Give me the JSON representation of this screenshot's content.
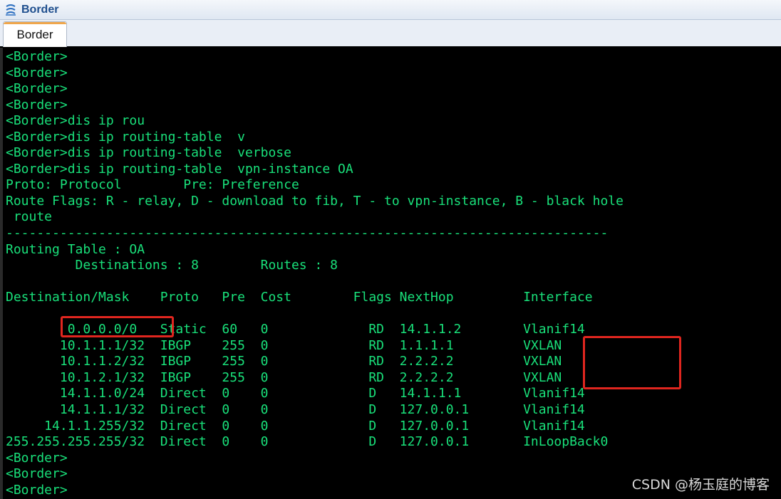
{
  "window": {
    "title": "Border",
    "icon": "network-device-icon"
  },
  "tabs": [
    {
      "label": "Border",
      "active": true
    }
  ],
  "terminal": {
    "text_color": "#19e07a",
    "background": "#000000",
    "lines": [
      "<Border>",
      "<Border>",
      "<Border>",
      "<Border>",
      "<Border>dis ip rou",
      "<Border>dis ip routing-table  v",
      "<Border>dis ip routing-table  verbose",
      "<Border>dis ip routing-table  vpn-instance OA",
      "Proto: Protocol        Pre: Preference",
      "Route Flags: R - relay, D - download to fib, T - to vpn-instance, B - black hole",
      " route",
      "------------------------------------------------------------------------------",
      "Routing Table : OA",
      "         Destinations : 8        Routes : 8",
      "",
      "Destination/Mask    Proto   Pre  Cost        Flags NextHop         Interface",
      "",
      "        0.0.0.0/0   Static  60   0             RD  14.1.1.2        Vlanif14",
      "       10.1.1.1/32  IBGP    255  0             RD  1.1.1.1         VXLAN",
      "       10.1.1.2/32  IBGP    255  0             RD  2.2.2.2         VXLAN",
      "       10.1.2.1/32  IBGP    255  0             RD  2.2.2.2         VXLAN",
      "       14.1.1.0/24  Direct  0    0             D   14.1.1.1        Vlanif14",
      "       14.1.1.1/32  Direct  0    0             D   127.0.0.1       Vlanif14",
      "     14.1.1.255/32  Direct  0    0             D   127.0.0.1       Vlanif14",
      "255.255.255.255/32  Direct  0    0             D   127.0.0.1       InLoopBack0",
      "<Border>",
      "<Border>",
      "<Border>"
    ]
  },
  "annotations": {
    "box_color": "#e0261f",
    "boxes": [
      "default-route-highlight",
      "vxlan-interface-highlight"
    ]
  },
  "watermark": "CSDN @杨玉庭的博客"
}
